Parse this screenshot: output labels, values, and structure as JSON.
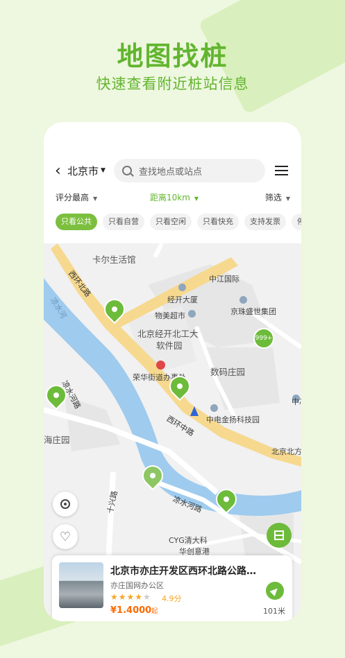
{
  "promo": {
    "title": "地图找桩",
    "subtitle": "快速查看附近桩站信息"
  },
  "topbar": {
    "city": "北京市",
    "search_placeholder": "查找地点或站点"
  },
  "sort": {
    "rating": "评分最高",
    "distance": "距离10km",
    "filter": "筛选"
  },
  "chips": [
    "只看公共",
    "只看自营",
    "只看空闲",
    "只看快充",
    "支持发票",
    "停"
  ],
  "map": {
    "labels": {
      "kaer": "卡尔生活馆",
      "zhongjiang": "中江国际",
      "jingkai": "经开大厦",
      "wumei": "物美超市",
      "jingzhu": "京珠盛世集团",
      "beijing_kaifa": "北京经开北工大",
      "ruanjian": "软件园",
      "shuma": "数码庄园",
      "ronghua": "荣华街道办事处",
      "zhongxin": "中芯国",
      "zhongdian": "中电金扬科技园",
      "haizhuang": "海庄园",
      "beijing_bei": "北京北方",
      "cyg": "CYG清大科",
      "huachuang": "华创意港",
      "road_xihuanbei": "西环北路",
      "road_xihuanzhong": "西环中路",
      "road_liangshuihe": "凉水河路",
      "road_liangshuihe2": "凉水河路",
      "road_shixing": "十兴路",
      "river": "凉水河"
    },
    "badge": "999+"
  },
  "station_card": {
    "title": "北京市亦庄开发区西环北路公路…",
    "subtitle": "亦庄国网办公区",
    "rating": 4.0,
    "rating_text": "4.9分",
    "price": "¥1.4000",
    "price_unit": "起",
    "distance": "101米"
  },
  "colors": {
    "brand_green": "#62b52f",
    "pin_green": "#6dbb3a",
    "river": "#9ecbee",
    "road_yellow": "#f6d98f",
    "price_orange": "#ff6a00"
  }
}
